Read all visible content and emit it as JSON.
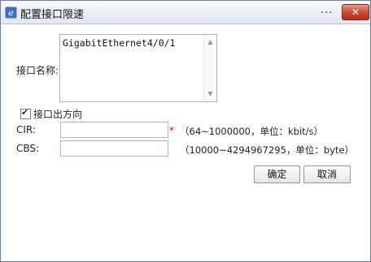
{
  "window": {
    "title": "配置接口限速",
    "more_label": "...",
    "close_label": "✕"
  },
  "form": {
    "interface_name_label": "接口名称:",
    "interface_name_value": "GigabitEthernet4/0/1",
    "direction_label": "接口出方向",
    "direction_checked": true,
    "cir_label": "CIR:",
    "cir_value": "",
    "cir_required": "*",
    "cir_hint": "（64~1000000，单位：kbit/s）",
    "cbs_label": "CBS:",
    "cbs_value": "",
    "cbs_hint": "（10000~4294967295，单位：byte）"
  },
  "buttons": {
    "ok": "确定",
    "cancel": "取消"
  },
  "icons": {
    "app": "ie-icon",
    "close": "close-icon",
    "scroll_up": "scroll-up-icon",
    "scroll_down": "scroll-down-icon",
    "check": "checkmark-icon"
  }
}
